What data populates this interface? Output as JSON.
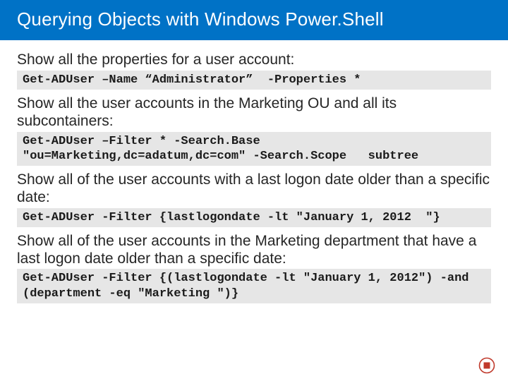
{
  "title": "Querying Objects with Windows Power.Shell",
  "sections": [
    {
      "desc": "Show all the properties for a user account:",
      "code": "Get-ADUser –Name “Administrator”  -Properties *"
    },
    {
      "desc": "Show all the user accounts in the Marketing OU and all its subcontainers:",
      "code": "Get-ADUser –Filter * -Search.Base \"ou=Marketing,dc=adatum,dc=com\" -Search.Scope   subtree"
    },
    {
      "desc": "Show all of the user accounts with a last logon date older than a specific date:",
      "code": "Get-ADUser -Filter {lastlogondate -lt \"January 1, 2012  \"}"
    },
    {
      "desc": "Show all of the user accounts in the Marketing department that have a last logon date older than a specific date:",
      "code": "Get-ADUser -Filter {(lastlogondate -lt \"January 1, 2012\") -and (department -eq \"Marketing \")}"
    }
  ],
  "icon_name": "stop-icon"
}
